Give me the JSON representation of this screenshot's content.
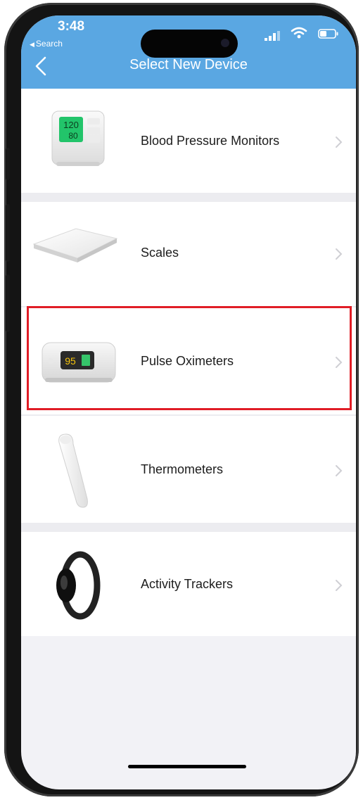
{
  "status_bar": {
    "time": "3:48",
    "back_app_label": "Search"
  },
  "nav": {
    "title": "Select New Device"
  },
  "devices": [
    {
      "label": "Blood Pressure Monitors",
      "icon": "blood-pressure-monitor"
    },
    {
      "label": "Scales",
      "icon": "scale"
    },
    {
      "label": "Pulse Oximeters",
      "icon": "pulse-oximeter",
      "highlighted": true
    },
    {
      "label": "Thermometers",
      "icon": "thermometer"
    },
    {
      "label": "Activity Trackers",
      "icon": "activity-tracker"
    }
  ],
  "device_readouts": {
    "bp_systolic": "120",
    "bp_diastolic": "80",
    "oximeter_spo2": "95"
  },
  "colors": {
    "header": "#5aa7e2",
    "highlight_border": "#e01d26",
    "background": "#f2f2f6"
  }
}
